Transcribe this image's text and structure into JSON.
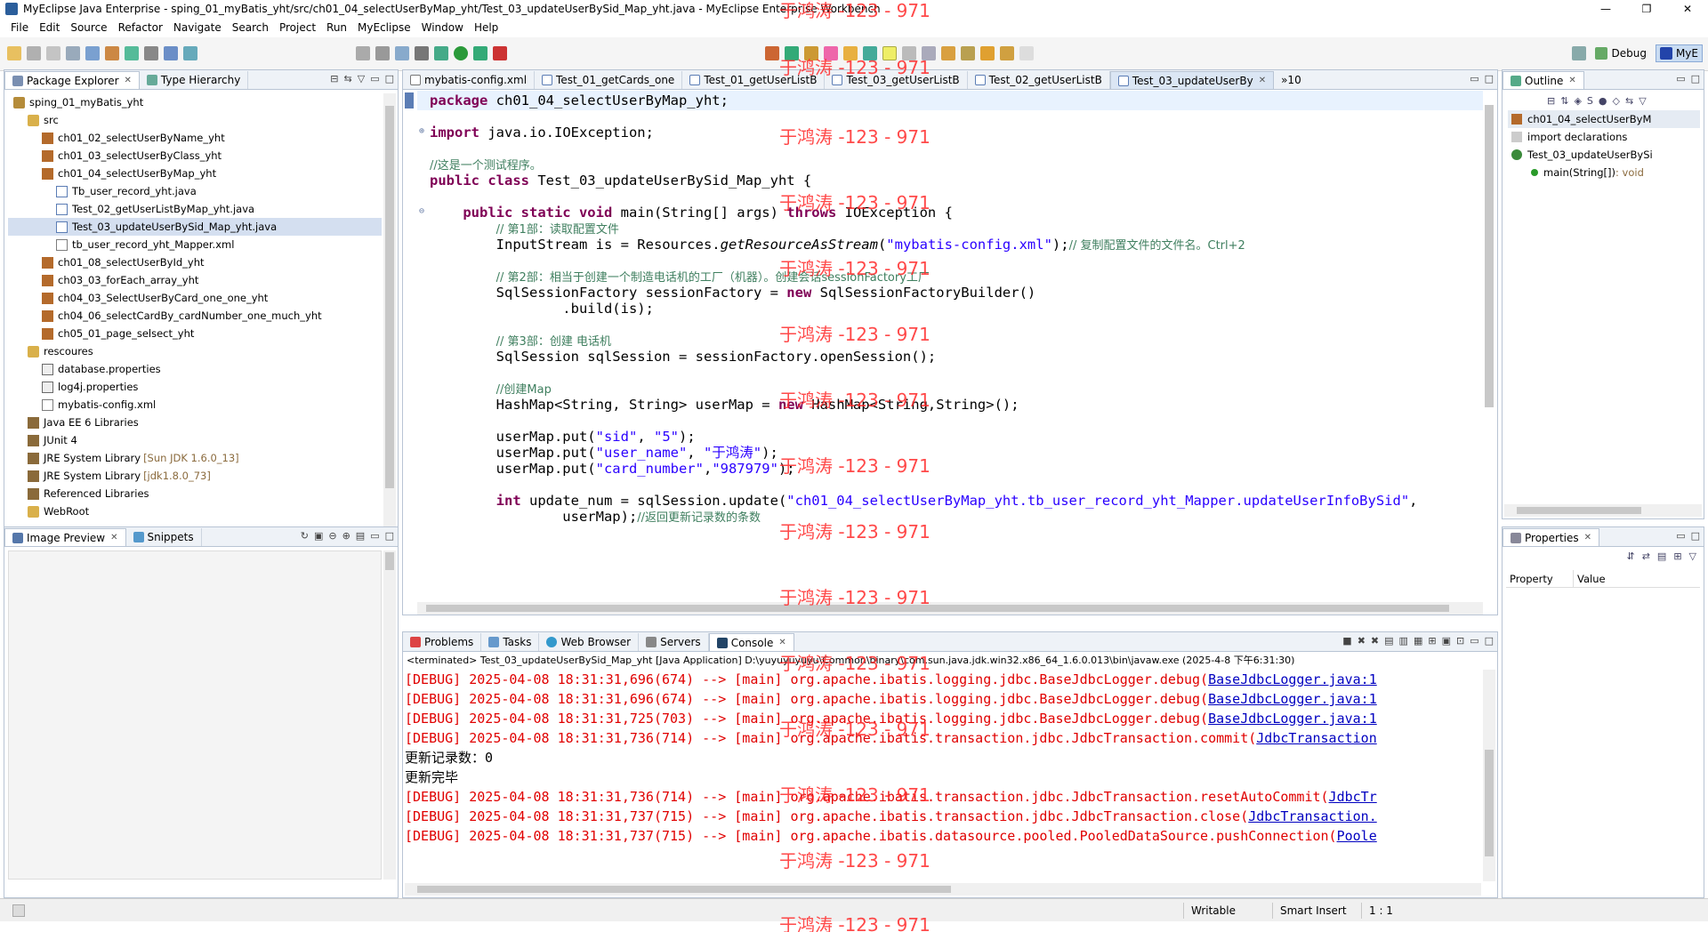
{
  "window": {
    "title": "MyEclipse Java Enterprise - sping_01_myBatis_yht/src/ch01_04_selectUserByMap_yht/Test_03_updateUserBySid_Map_yht.java - MyEclipse Enterprise Workbench",
    "minimize": "—",
    "maximize": "❐",
    "close": "✕"
  },
  "menu": [
    "File",
    "Edit",
    "Source",
    "Refactor",
    "Navigate",
    "Search",
    "Project",
    "Run",
    "MyEclipse",
    "Window",
    "Help"
  ],
  "perspectives": {
    "debug": "Debug",
    "myeclipse": "MyE"
  },
  "package_explorer": {
    "tabs": [
      "Package Explorer",
      "Type Hierarchy"
    ],
    "tree": [
      {
        "label": "sping_01_myBatis_yht",
        "icon": "project-icon",
        "level": 0
      },
      {
        "label": "src",
        "icon": "folder-icon",
        "level": 1
      },
      {
        "label": "ch01_02_selectUserByName_yht",
        "icon": "package-icon",
        "level": 2
      },
      {
        "label": "ch01_03_selectUserByClass_yht",
        "icon": "package-icon",
        "level": 2
      },
      {
        "label": "ch01_04_selectUserByMap_yht",
        "icon": "package-icon",
        "level": 2
      },
      {
        "label": "Tb_user_record_yht.java",
        "icon": "java-file-icon",
        "level": 3
      },
      {
        "label": "Test_02_getUserListByMap_yht.java",
        "icon": "java-file-icon",
        "level": 3
      },
      {
        "label": "Test_03_updateUserBySid_Map_yht.java",
        "icon": "java-file-icon",
        "level": 3,
        "selected": true
      },
      {
        "label": "tb_user_record_yht_Mapper.xml",
        "icon": "xml-file-icon",
        "level": 3
      },
      {
        "label": "ch01_08_selectUserById_yht",
        "icon": "package-icon",
        "level": 2
      },
      {
        "label": "ch03_03_forEach_array_yht",
        "icon": "package-icon",
        "level": 2
      },
      {
        "label": "ch04_03_SelectUserByCard_one_one_yht",
        "icon": "package-icon",
        "level": 2
      },
      {
        "label": "ch04_06_selectCardBy_cardNumber_one_much_yht",
        "icon": "package-icon",
        "level": 2
      },
      {
        "label": "ch05_01_page_selsect_yht",
        "icon": "package-icon",
        "level": 2
      },
      {
        "label": "rescoures",
        "icon": "folder-icon",
        "level": 1
      },
      {
        "label": "database.properties",
        "icon": "properties-file-icon",
        "level": 2
      },
      {
        "label": "log4j.properties",
        "icon": "properties-file-icon",
        "level": 2
      },
      {
        "label": "mybatis-config.xml",
        "icon": "xml-file-icon",
        "level": 2
      },
      {
        "label": "Java EE 6 Libraries",
        "icon": "library-icon",
        "level": 1
      },
      {
        "label": "JUnit 4",
        "icon": "library-icon",
        "level": 1
      },
      {
        "label": "JRE System Library",
        "extra": "[Sun JDK 1.6.0_13]",
        "icon": "library-icon",
        "level": 1
      },
      {
        "label": "JRE System Library",
        "extra": "[jdk1.8.0_73]",
        "icon": "library-icon",
        "level": 1
      },
      {
        "label": "Referenced Libraries",
        "icon": "library-icon",
        "level": 1
      },
      {
        "label": "WebRoot",
        "icon": "folder-icon",
        "level": 1
      }
    ]
  },
  "image_preview": {
    "tabs": [
      "Image Preview",
      "Snippets"
    ]
  },
  "editor": {
    "tabs": [
      "mybatis-config.xml",
      "Test_01_getCards_one",
      "Test_01_getUserListB",
      "Test_03_getUserListB",
      "Test_02_getUserListB",
      "Test_03_updateUserBy"
    ],
    "overflow": "»10",
    "active_tab": 5
  },
  "bottom": {
    "tabs": [
      "Problems",
      "Tasks",
      "Web Browser",
      "Servers",
      "Console"
    ],
    "console_info": "<terminated> Test_03_updateUserBySid_Map_yht [Java Application] D:\\yuyuyuyuyu\\Common\\binary\\com.sun.java.jdk.win32.x86_64_1.6.0.013\\bin\\javaw.exe (2025-4-8 下午6:31:30)",
    "lines": [
      {
        "kind": "debug",
        "text": "[DEBUG] 2025-04-08 18:31:31,696(674) --> [main] org.apache.ibatis.logging.jdbc.BaseJdbcLogger.debug(",
        "link": "BaseJdbcLogger.java:1"
      },
      {
        "kind": "debug",
        "text": "[DEBUG] 2025-04-08 18:31:31,696(674) --> [main] org.apache.ibatis.logging.jdbc.BaseJdbcLogger.debug(",
        "link": "BaseJdbcLogger.java:1"
      },
      {
        "kind": "debug",
        "text": "[DEBUG] 2025-04-08 18:31:31,725(703) --> [main] org.apache.ibatis.logging.jdbc.BaseJdbcLogger.debug(",
        "link": "BaseJdbcLogger.java:1"
      },
      {
        "kind": "debug",
        "text": "[DEBUG] 2025-04-08 18:31:31,736(714) --> [main] org.apache.ibatis.transaction.jdbc.JdbcTransaction.commit(",
        "link": "JdbcTransaction"
      },
      {
        "kind": "out",
        "text": "更新记录数：0",
        "link": ""
      },
      {
        "kind": "out",
        "text": "更新完毕",
        "link": ""
      },
      {
        "kind": "debug",
        "text": "[DEBUG] 2025-04-08 18:31:31,736(714) --> [main] org.apache.ibatis.transaction.jdbc.JdbcTransaction.resetAutoCommit(",
        "link": "JdbcTr"
      },
      {
        "kind": "debug",
        "text": "[DEBUG] 2025-04-08 18:31:31,737(715) --> [main] org.apache.ibatis.transaction.jdbc.JdbcTransaction.close(",
        "link": "JdbcTransaction."
      },
      {
        "kind": "debug",
        "text": "[DEBUG] 2025-04-08 18:31:31,737(715) --> [main] org.apache.ibatis.datasource.pooled.PooledDataSource.pushConnection(",
        "link": "Poole"
      }
    ]
  },
  "outline": {
    "tab": "Outline",
    "items": [
      {
        "label": "ch01_04_selectUserByM",
        "extra": ""
      },
      {
        "label": "import declarations",
        "extra": ""
      },
      {
        "label": "Test_03_updateUserBySi",
        "extra": ""
      },
      {
        "label": "main(String[])",
        "extra": ": void"
      }
    ]
  },
  "properties": {
    "tab": "Properties",
    "col_property": "Property",
    "col_value": "Value"
  },
  "status": {
    "writable": "Writable",
    "insert_mode": "Smart Insert",
    "position": "1 : 1"
  },
  "watermark": "于鸿涛 -123 - 971"
}
